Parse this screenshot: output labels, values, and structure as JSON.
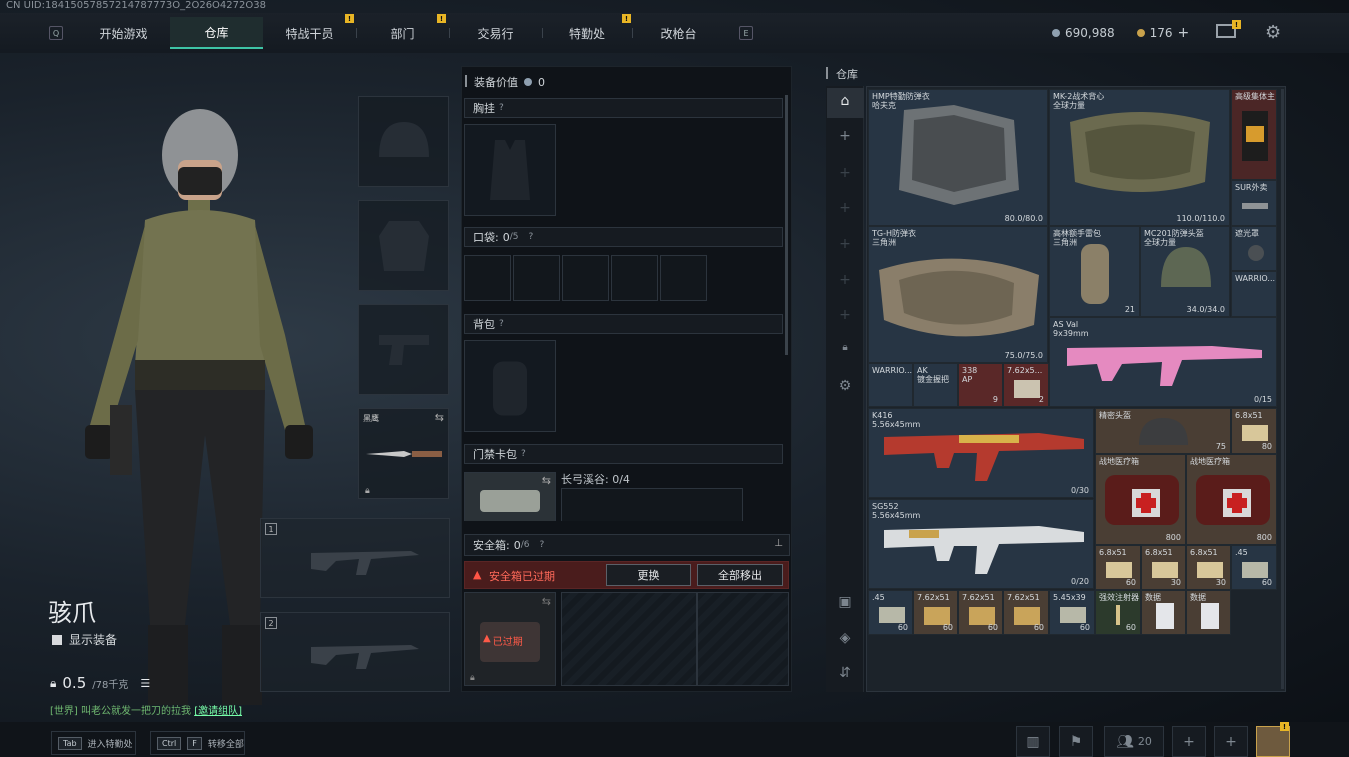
{
  "uid": "CN UID:18415057857214787773O_2O26O4272O38",
  "nav": {
    "key_left": "Q",
    "key_right": "E",
    "tabs": [
      {
        "label": "开始游戏",
        "badge": false
      },
      {
        "label": "仓库",
        "badge": false,
        "active": true
      },
      {
        "label": "特战干员",
        "badge": true
      },
      {
        "label": "部门",
        "badge": true
      },
      {
        "label": "交易行",
        "badge": false
      },
      {
        "label": "特勤处",
        "badge": true
      },
      {
        "label": "改枪台",
        "badge": false
      }
    ],
    "badge_text": "!"
  },
  "currency": {
    "silver": "690,988",
    "gold": "176",
    "add": "+"
  },
  "operator": {
    "name": "骇爪",
    "show_equipment": "显示装备",
    "weight": "0.5",
    "weight_max": "/78千克"
  },
  "chat": {
    "channel": "[世界]",
    "text": "叫老公就发一把刀的拉我",
    "link": "[邀请组队]"
  },
  "gear": {
    "melee_name": "黑鹰",
    "weapon_slot1": "1",
    "weapon_slot2": "2"
  },
  "middle": {
    "equip_value_label": "装备价值",
    "equip_value": "0",
    "chest_rig": "胸挂",
    "pocket": "口袋:",
    "pocket_count": "0",
    "pocket_max": "/5",
    "backpack": "背包",
    "keycard": "门禁卡包",
    "keycard_note": "长弓溪谷: 0/4",
    "safebox": "安全箱:",
    "safebox_count": "0",
    "safebox_max": "/6",
    "expired_warning": "安全箱已过期",
    "replace_button": "更换",
    "remove_all_button": "全部移出",
    "expired_badge": "已过期",
    "help": "?"
  },
  "stash": {
    "title": "仓库",
    "items": [
      {
        "name": "HMP特勤防弹衣\n哈夫克",
        "bottom": "80.0/80.0"
      },
      {
        "name": "MK-2战术背心\n全球力量",
        "bottom": "110.0/110.0"
      },
      {
        "name": "高级集体主",
        "bottom": ""
      },
      {
        "name": "SUR外卖",
        "bottom": ""
      },
      {
        "name": "TG-H防弹衣\n三角洲",
        "bottom": "75.0/75.0"
      },
      {
        "name": "高林额手雷包\n三角洲",
        "bottom": "21"
      },
      {
        "name": "MC201防弹头盔\n全球力量",
        "bottom": "34.0/34.0"
      },
      {
        "name": "遮光罩",
        "bottom": ""
      },
      {
        "name": "WARRIO...",
        "bottom": ""
      },
      {
        "name": "AS Val\n9x39mm",
        "bottom": "0/15"
      },
      {
        "name": "WARRIO...",
        "bottom": ""
      },
      {
        "name": "AK\n镀金握把",
        "bottom": ""
      },
      {
        "name": "338\nAP",
        "bottom": "9"
      },
      {
        "name": "7.62x5...",
        "bottom": "2"
      },
      {
        "name": "K416\n5.56x45mm",
        "bottom": "0/30"
      },
      {
        "name": "精密头盔",
        "bottom": "75"
      },
      {
        "name": "6.8x51",
        "bottom": "80"
      },
      {
        "name": "SG552\n5.56x45mm",
        "bottom": "0/20"
      },
      {
        "name": "战地医疗箱",
        "bottom": "800"
      },
      {
        "name": "战地医疗箱",
        "bottom": "800"
      },
      {
        "name": "6.8x51",
        "bottom": "60"
      },
      {
        "name": "6.8x51",
        "bottom": "30"
      },
      {
        "name": "6.8x51",
        "bottom": "30"
      },
      {
        "name": ".45",
        "bottom": "60"
      },
      {
        "name": ".45",
        "bottom": "60"
      },
      {
        "name": "7.62x51",
        "bottom": "60"
      },
      {
        "name": "7.62x51",
        "bottom": "60"
      },
      {
        "name": "7.62x51",
        "bottom": "60"
      },
      {
        "name": "5.45x39",
        "bottom": "60"
      },
      {
        "name": "强效注射器",
        "bottom": "60"
      },
      {
        "name": "数据",
        "bottom": ""
      },
      {
        "name": "数据",
        "bottom": ""
      }
    ]
  },
  "bottom": {
    "tab_key": "Tab",
    "tab_label": "进入特勤处",
    "ctrl_key": "Ctrl",
    "f_key": "F",
    "transfer_label": "转移全部",
    "friends_count": "20",
    "plus": "+"
  },
  "colors": {
    "accent": "#3ec4a6",
    "warning": "#e04a3a",
    "badge": "#e8b525"
  }
}
